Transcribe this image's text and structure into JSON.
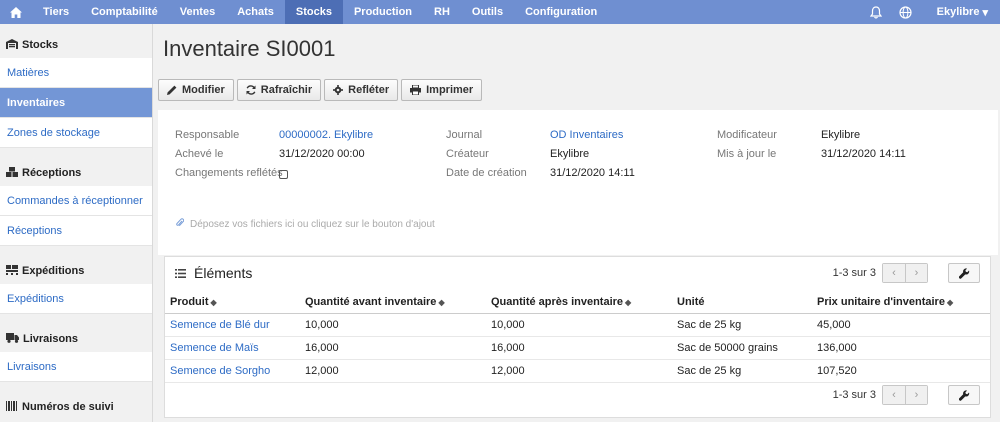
{
  "nav": {
    "items": [
      {
        "label": "Tiers"
      },
      {
        "label": "Comptabilité"
      },
      {
        "label": "Ventes"
      },
      {
        "label": "Achats"
      },
      {
        "label": "Stocks"
      },
      {
        "label": "Production"
      },
      {
        "label": "RH"
      },
      {
        "label": "Outils"
      },
      {
        "label": "Configuration"
      }
    ],
    "active": "Stocks",
    "user": "Ekylibre",
    "accent": "#6f8fd1"
  },
  "sidebar": {
    "sections": [
      {
        "title": "Stocks",
        "icon": "warehouse-icon",
        "items": [
          "Matières",
          "Inventaires",
          "Zones de stockage"
        ]
      },
      {
        "title": "Réceptions",
        "icon": "boxes-icon",
        "items": [
          "Commandes à réceptionner",
          "Réceptions"
        ]
      },
      {
        "title": "Expéditions",
        "icon": "pallet-icon",
        "items": [
          "Expéditions"
        ]
      },
      {
        "title": "Livraisons",
        "icon": "truck-icon",
        "items": [
          "Livraisons"
        ]
      },
      {
        "title": "Numéros de suivi",
        "icon": "barcode-icon",
        "items": []
      }
    ],
    "active_item": "Inventaires"
  },
  "page": {
    "title": "Inventaire SI0001",
    "toolbar": {
      "edit": "Modifier",
      "refresh": "Rafraîchir",
      "reflect": "Refléter",
      "print": "Imprimer"
    },
    "info": {
      "responsable_label": "Responsable",
      "responsable_value": "00000002. Ekylibre",
      "acheve_label": "Achevé le",
      "acheve_value": "31/12/2020 00:00",
      "changements_label": "Changements reflétés",
      "journal_label": "Journal",
      "journal_value": "OD Inventaires",
      "createur_label": "Créateur",
      "createur_value": "Ekylibre",
      "date_creation_label": "Date de création",
      "date_creation_value": "31/12/2020 14:11",
      "modificateur_label": "Modificateur",
      "modificateur_value": "Ekylibre",
      "maj_label": "Mis à jour le",
      "maj_value": "31/12/2020 14:11"
    },
    "dropzone": "Déposez vos fichiers ici ou cliquez sur le bouton d'ajout"
  },
  "elements": {
    "title": "Éléments",
    "pager_top": "1-3 sur 3",
    "pager_bottom": "1-3 sur 3",
    "columns": [
      "Produit",
      "Quantité avant inventaire",
      "Quantité après inventaire",
      "Unité",
      "Prix unitaire d'inventaire"
    ],
    "rows": [
      {
        "product": "Semence de Blé dur",
        "before": "10,000",
        "after": "10,000",
        "unit": "Sac de 25 kg",
        "price": "45,000"
      },
      {
        "product": "Semence de Maïs",
        "before": "16,000",
        "after": "16,000",
        "unit": "Sac de 50000 grains",
        "price": "136,000"
      },
      {
        "product": "Semence de Sorgho",
        "before": "12,000",
        "after": "12,000",
        "unit": "Sac de 25 kg",
        "price": "107,520"
      }
    ]
  }
}
